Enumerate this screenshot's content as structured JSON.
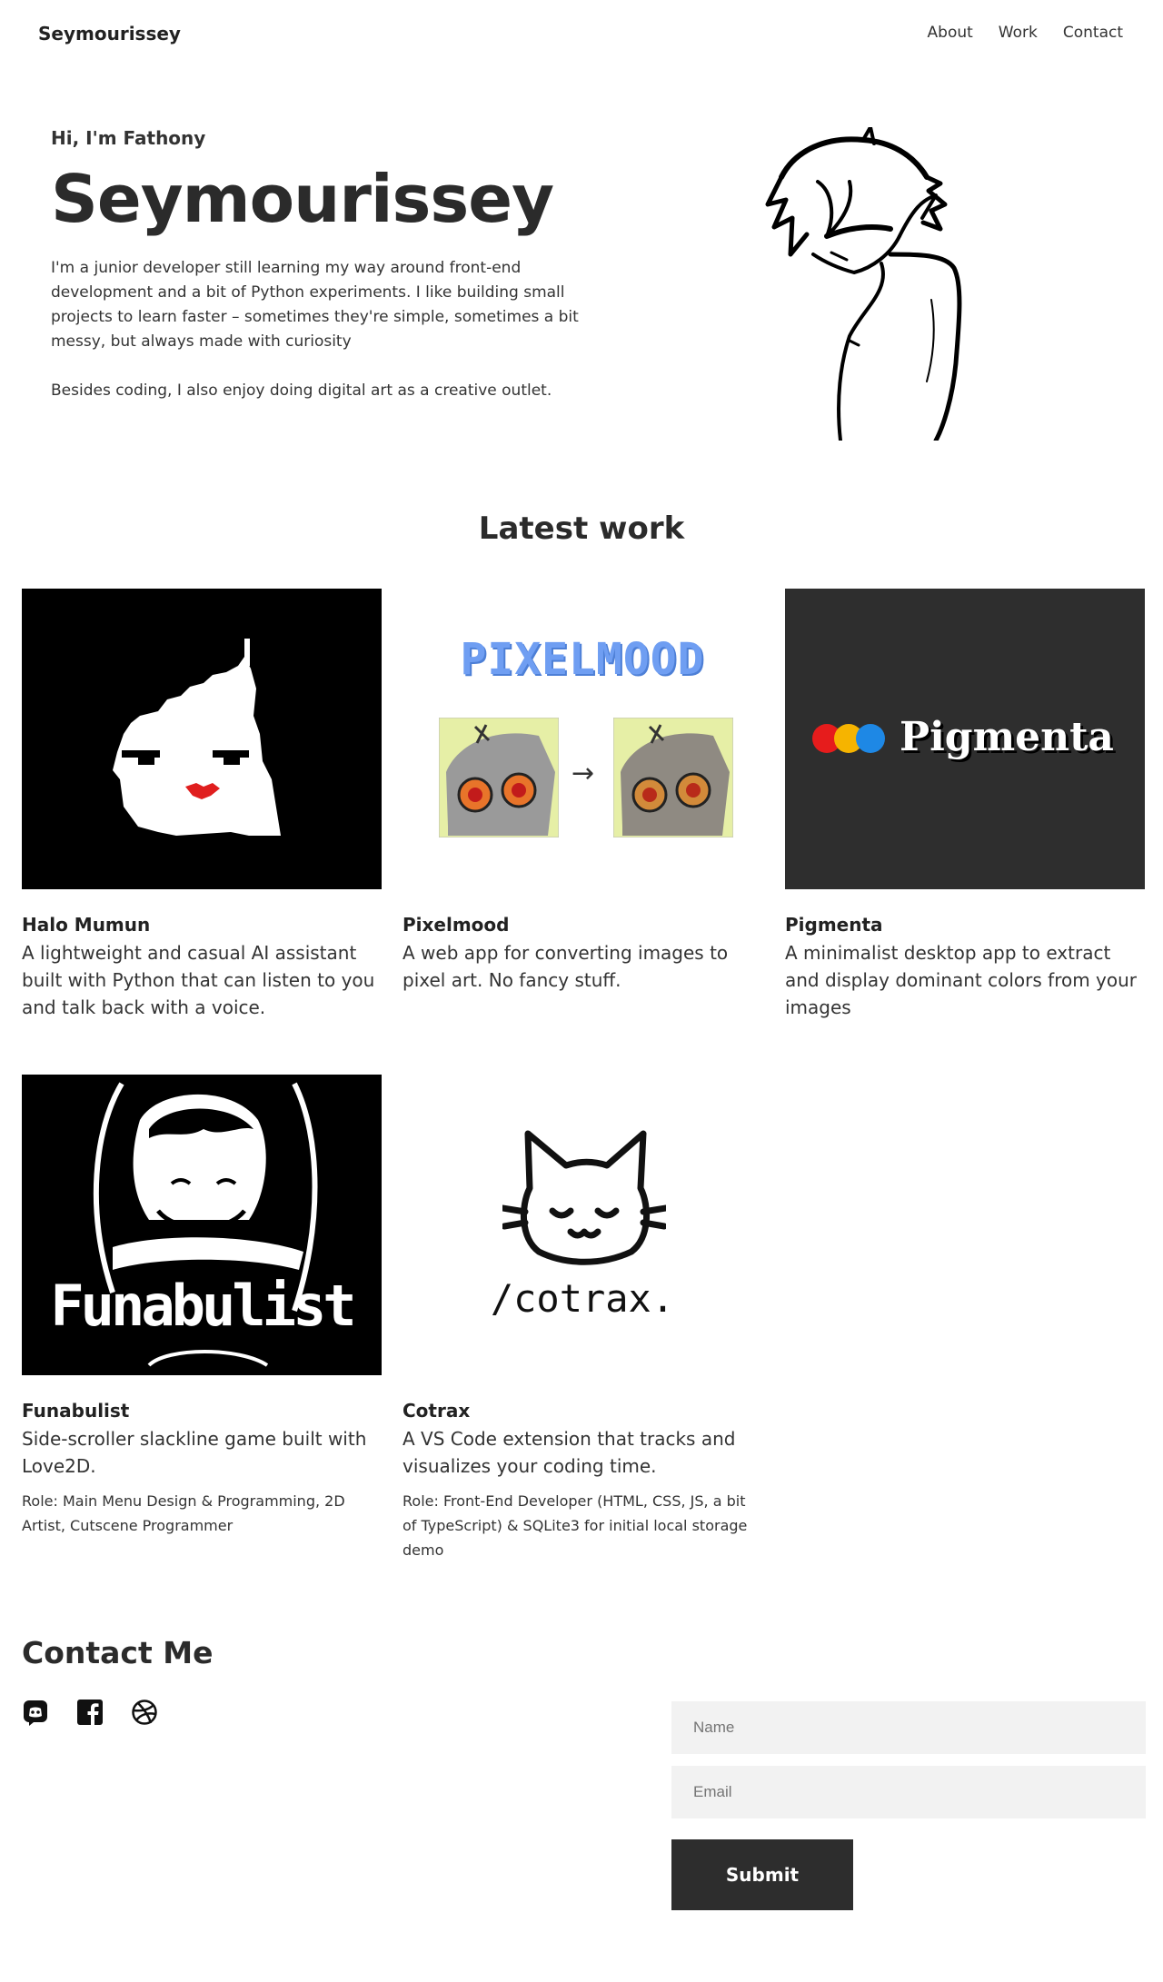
{
  "nav": {
    "brand": "Seymourissey",
    "links": [
      "About",
      "Work",
      "Contact"
    ]
  },
  "hero": {
    "greeting": "Hi, I'm Fathony",
    "title": "Seymourissey",
    "paragraph1": "I'm a junior developer still learning my way around front-end development and a bit of Python experiments. I like building small projects to learn faster – sometimes they're simple, sometimes a bit messy, but always made with curiosity",
    "paragraph2": "Besides coding, I also enjoy doing digital art as a creative outlet."
  },
  "work": {
    "title": "Latest work",
    "projects": [
      {
        "name": "Halo Mumun",
        "description": "A lightweight and casual AI assistant built with Python that can listen to you and talk back with a voice.",
        "role": ""
      },
      {
        "name": "Pixelmood",
        "description": "A web app for converting images to pixel art. No fancy stuff.",
        "role": "",
        "thumb_text": "PIXELMOOD"
      },
      {
        "name": "Pigmenta",
        "description": "A minimalist desktop app to extract and display dominant colors from your images",
        "role": "",
        "thumb_text": "Pigmenta"
      },
      {
        "name": "Funabulist",
        "description": "Side-scroller slackline game built with Love2D.",
        "role": "Role:  Main Menu Design & Programming, 2D Artist, Cutscene Programmer",
        "thumb_text": "Funabulist"
      },
      {
        "name": "Cotrax",
        "description": "A VS Code extension that tracks and visualizes your coding time.",
        "role": "Role: Front-End Developer (HTML, CSS, JS, a bit of TypeScript) & SQLite3 for initial local storage demo",
        "thumb_text": "/cotrax."
      }
    ]
  },
  "contact": {
    "title": "Contact Me",
    "socials": [
      "discord-icon",
      "facebook-icon",
      "dribbble-icon"
    ],
    "name_placeholder": "Name",
    "email_placeholder": "Email",
    "submit_label": "Submit"
  },
  "colors": {
    "text": "#2b2b2b",
    "button_bg": "#2d2d2d",
    "field_bg": "#f2f2f2",
    "pixelmood_blue": "#6f9ef2",
    "pigmenta_bg": "#2e2e2e"
  }
}
